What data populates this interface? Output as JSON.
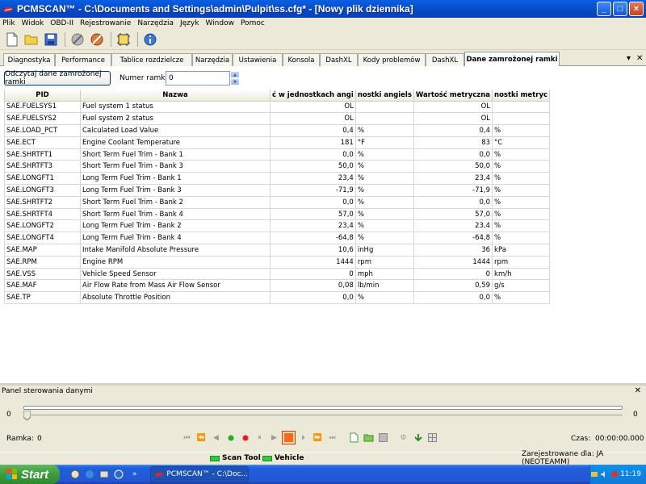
{
  "window": {
    "title": "PCMSCAN™ - C:\\Documents and Settings\\admin\\Pulpit\\ss.cfg* - [Nowy plik dziennika]",
    "min_label": "_",
    "max_label": "□",
    "close_label": "×"
  },
  "menu": [
    "Plik",
    "Widok",
    "OBD-II",
    "Rejestrowanie",
    "Narzędzia",
    "Język",
    "Window",
    "Pomoc"
  ],
  "toolbar_icons": [
    "new-file-icon",
    "open-folder-icon",
    "save-icon",
    "connect-icon",
    "disconnect-icon",
    "vehicle-settings-icon",
    "about-icon"
  ],
  "tabs": [
    "Diagnostyka",
    "Performance",
    "Tablice rozdzielcze",
    "Narzędzia",
    "Ustawienia",
    "Konsola",
    "DashXL",
    "Kody problemów",
    "DashXL",
    "Dane zamrożonej ramki"
  ],
  "active_tab": 9,
  "tab_controls": {
    "dropdown": "▾",
    "close": "✕"
  },
  "freeze": {
    "read_button": "Odczytaj dane zamrożonej ramki",
    "frame_label": "Numer ramki:",
    "frame_value": "0"
  },
  "table": {
    "columns": [
      "PID",
      "Nazwa",
      "ć w jednostkach angi",
      "nostki angiels",
      "Wartość metryczna",
      "nostki metryc"
    ],
    "rows": [
      [
        "SAE.FUELSYS1",
        "Fuel system 1 status",
        "OL",
        "",
        "OL",
        ""
      ],
      [
        "SAE.FUELSYS2",
        "Fuel system 2 status",
        "OL",
        "",
        "OL",
        ""
      ],
      [
        "SAE.LOAD_PCT",
        "Calculated Load Value",
        "0,4",
        "%",
        "0,4",
        "%"
      ],
      [
        "SAE.ECT",
        "Engine Coolant Temperature",
        "181",
        "°F",
        "83",
        "°C"
      ],
      [
        "SAE.SHRTFT1",
        "Short Term Fuel Trim - Bank 1",
        "0,0",
        "%",
        "0,0",
        "%"
      ],
      [
        "SAE.SHRTFT3",
        "Short Term Fuel Trim - Bank 3",
        "50,0",
        "%",
        "50,0",
        "%"
      ],
      [
        "SAE.LONGFT1",
        "Long Term Fuel Trim - Bank 1",
        "23,4",
        "%",
        "23,4",
        "%"
      ],
      [
        "SAE.LONGFT3",
        "Long Term Fuel Trim - Bank 3",
        "-71,9",
        "%",
        "-71,9",
        "%"
      ],
      [
        "SAE.SHRTFT2",
        "Short Term Fuel Trim - Bank 2",
        "0,0",
        "%",
        "0,0",
        "%"
      ],
      [
        "SAE.SHRTFT4",
        "Short Term Fuel Trim - Bank 4",
        "57,0",
        "%",
        "57,0",
        "%"
      ],
      [
        "SAE.LONGFT2",
        "Long Term Fuel Trim - Bank 2",
        "23,4",
        "%",
        "23,4",
        "%"
      ],
      [
        "SAE.LONGFT4",
        "Long Term Fuel Trim - Bank 4",
        "-64,8",
        "%",
        "-64,8",
        "%"
      ],
      [
        "SAE.MAP",
        "Intake Manifold Absolute Pressure",
        "10,6",
        "inHg",
        "36",
        "kPa"
      ],
      [
        "SAE.RPM",
        "Engine RPM",
        "1444",
        "rpm",
        "1444",
        "rpm"
      ],
      [
        "SAE.VSS",
        "Vehicle Speed Sensor",
        "0",
        "mph",
        "0",
        "km/h"
      ],
      [
        "SAE.MAF",
        "Air Flow Rate from Mass Air Flow Sensor",
        "0,08",
        "lb/min",
        "0,59",
        "g/s"
      ],
      [
        "SAE.TP",
        "Absolute Throttle Position",
        "0,0",
        "%",
        "0,0",
        "%"
      ]
    ]
  },
  "control_panel": {
    "title": "Panel sterowania danymi",
    "close": "✕",
    "slider_min": "0",
    "slider_max": "0",
    "frame_label": "Ramka:",
    "frame_value": "0",
    "time_label": "Czas:",
    "time_value": "00:00:00.000"
  },
  "status": {
    "scan_tool": "Scan Tool",
    "vehicle": "Vehicle",
    "registered": "Zarejestrowane dla: JA (NEOTEAMM)"
  },
  "taskbar": {
    "start": "Start",
    "item": "PCMSCAN™ - C:\\Doc...",
    "clock": "11:19",
    "chevron": "»"
  },
  "colors": {
    "title_blue": "#0549c7",
    "status_green": "#2ecc3a",
    "record_orange": "#ff6a1a",
    "play_green": "#22aa22",
    "record_red": "#e02020"
  }
}
